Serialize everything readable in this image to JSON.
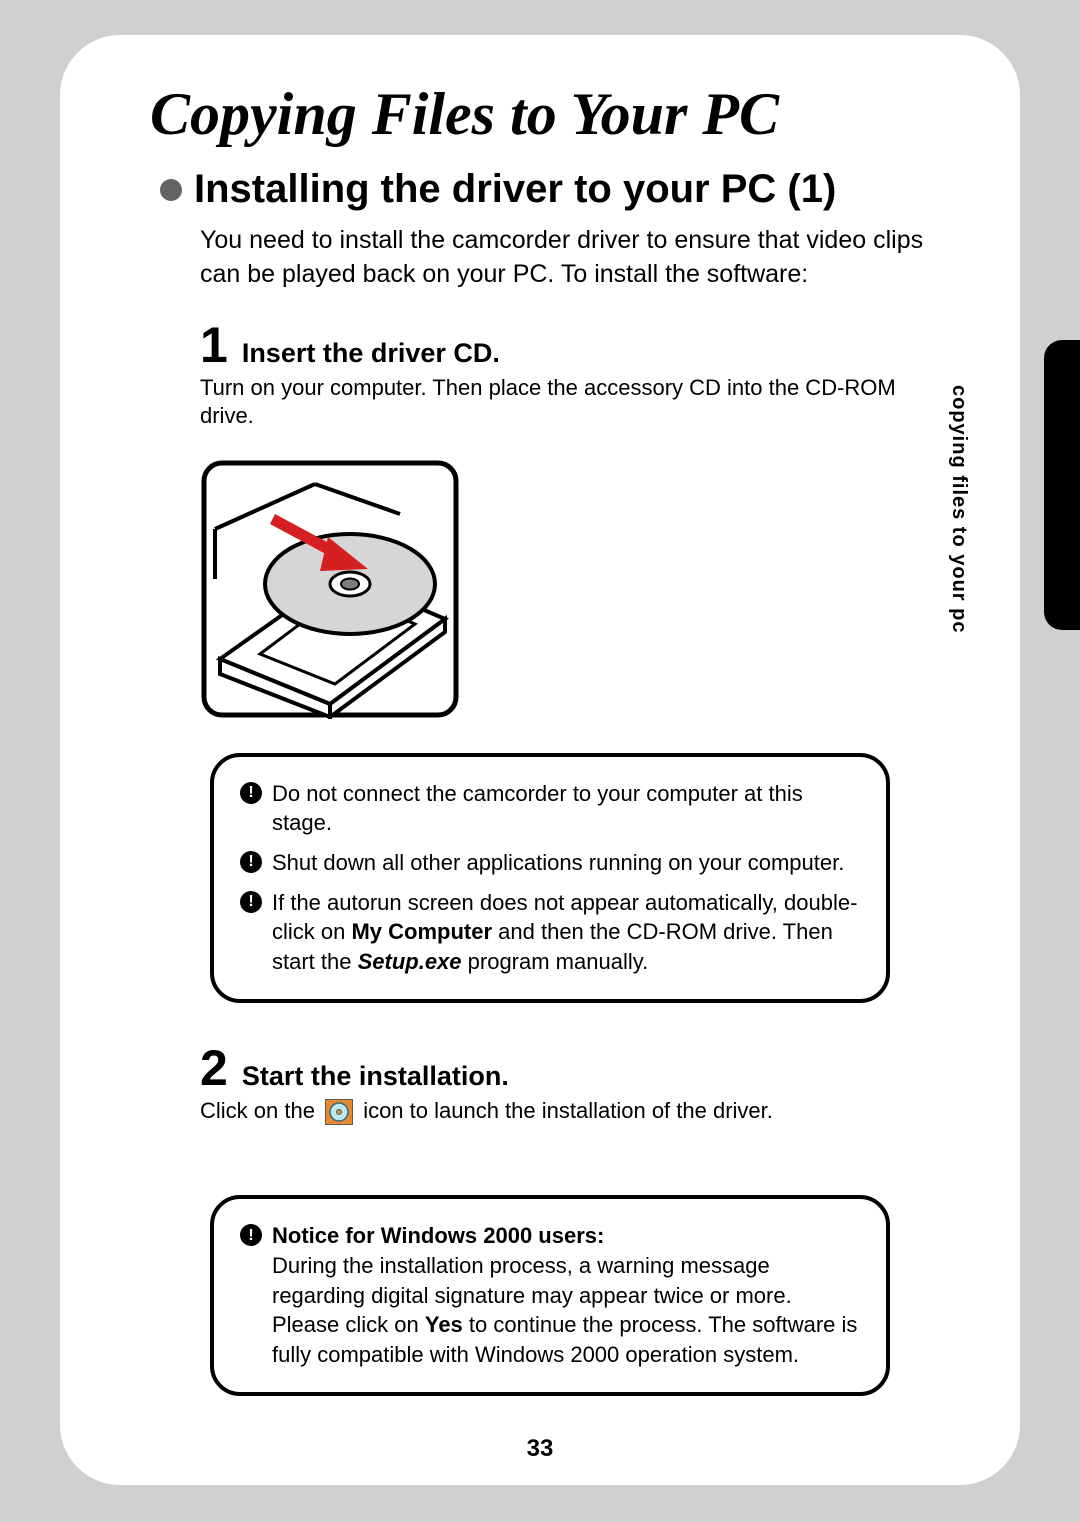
{
  "page_title": "Copying Files to Your PC",
  "section_title": "Installing the driver to your PC (1)",
  "intro": "You need to install the camcorder driver to ensure that video clips can be played back on your PC. To install the software:",
  "side_label": "copying files to your pc",
  "page_number": "33",
  "step1": {
    "num": "1",
    "title": "Insert the driver CD.",
    "body": "Turn on your computer. Then place the accessory CD into the CD-ROM drive."
  },
  "notice1": {
    "line1": "Do not connect the camcorder to your computer at this stage.",
    "line2": "Shut down all other applications running on your computer.",
    "line3_a": "If the autorun screen does not appear automatically, double-click on ",
    "line3_bold": "My Computer",
    "line3_b": " and then the CD-ROM drive. Then start the ",
    "line3_italic": "Setup.exe",
    "line3_c": " program manually."
  },
  "step2": {
    "num": "2",
    "title": "Start the installation.",
    "body_a": "Click on the ",
    "body_b": " icon to launch the installation of the driver."
  },
  "notice2": {
    "heading": "Notice for Windows 2000 users:",
    "body_a": "During the installation process, a warning message regarding digital signature may appear twice or more. Please click on ",
    "body_bold": "Yes",
    "body_b": " to continue the process. The software is fully compatible with Windows 2000 operation system."
  }
}
